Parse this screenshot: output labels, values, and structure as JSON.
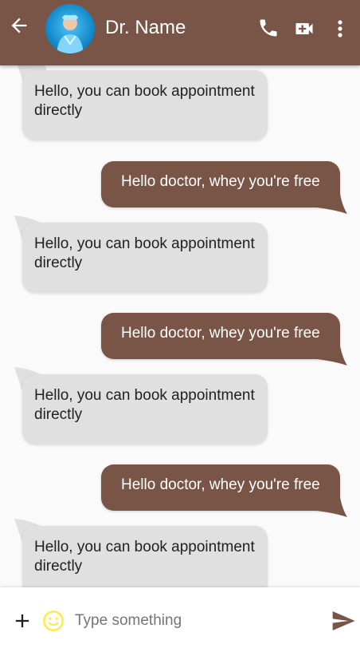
{
  "header": {
    "title": "Dr. Name",
    "back_icon": "arrow-back-icon",
    "call_icon": "phone-icon",
    "video_icon": "video-call-icon",
    "more_icon": "more-vert-icon"
  },
  "colors": {
    "primary": "#795548",
    "incoming_bubble": "#e0e0e0",
    "background": "#fafafa",
    "emoji": "#ffeb3b"
  },
  "messages": [
    {
      "direction": "in",
      "text": "Hello, you can book appointment directly"
    },
    {
      "direction": "out",
      "text": "Hello doctor, whey you're free"
    },
    {
      "direction": "in",
      "text": "Hello, you can book appointment directly"
    },
    {
      "direction": "out",
      "text": "Hello doctor, whey you're free"
    },
    {
      "direction": "in",
      "text": "Hello, you can book appointment directly"
    },
    {
      "direction": "out",
      "text": "Hello doctor, whey you're free"
    },
    {
      "direction": "in",
      "text": "Hello, you can book appointment directly"
    }
  ],
  "composer": {
    "placeholder": "Type something",
    "value": "",
    "add_icon": "plus-icon",
    "emoji_icon": "emoji-icon",
    "send_icon": "send-icon"
  }
}
